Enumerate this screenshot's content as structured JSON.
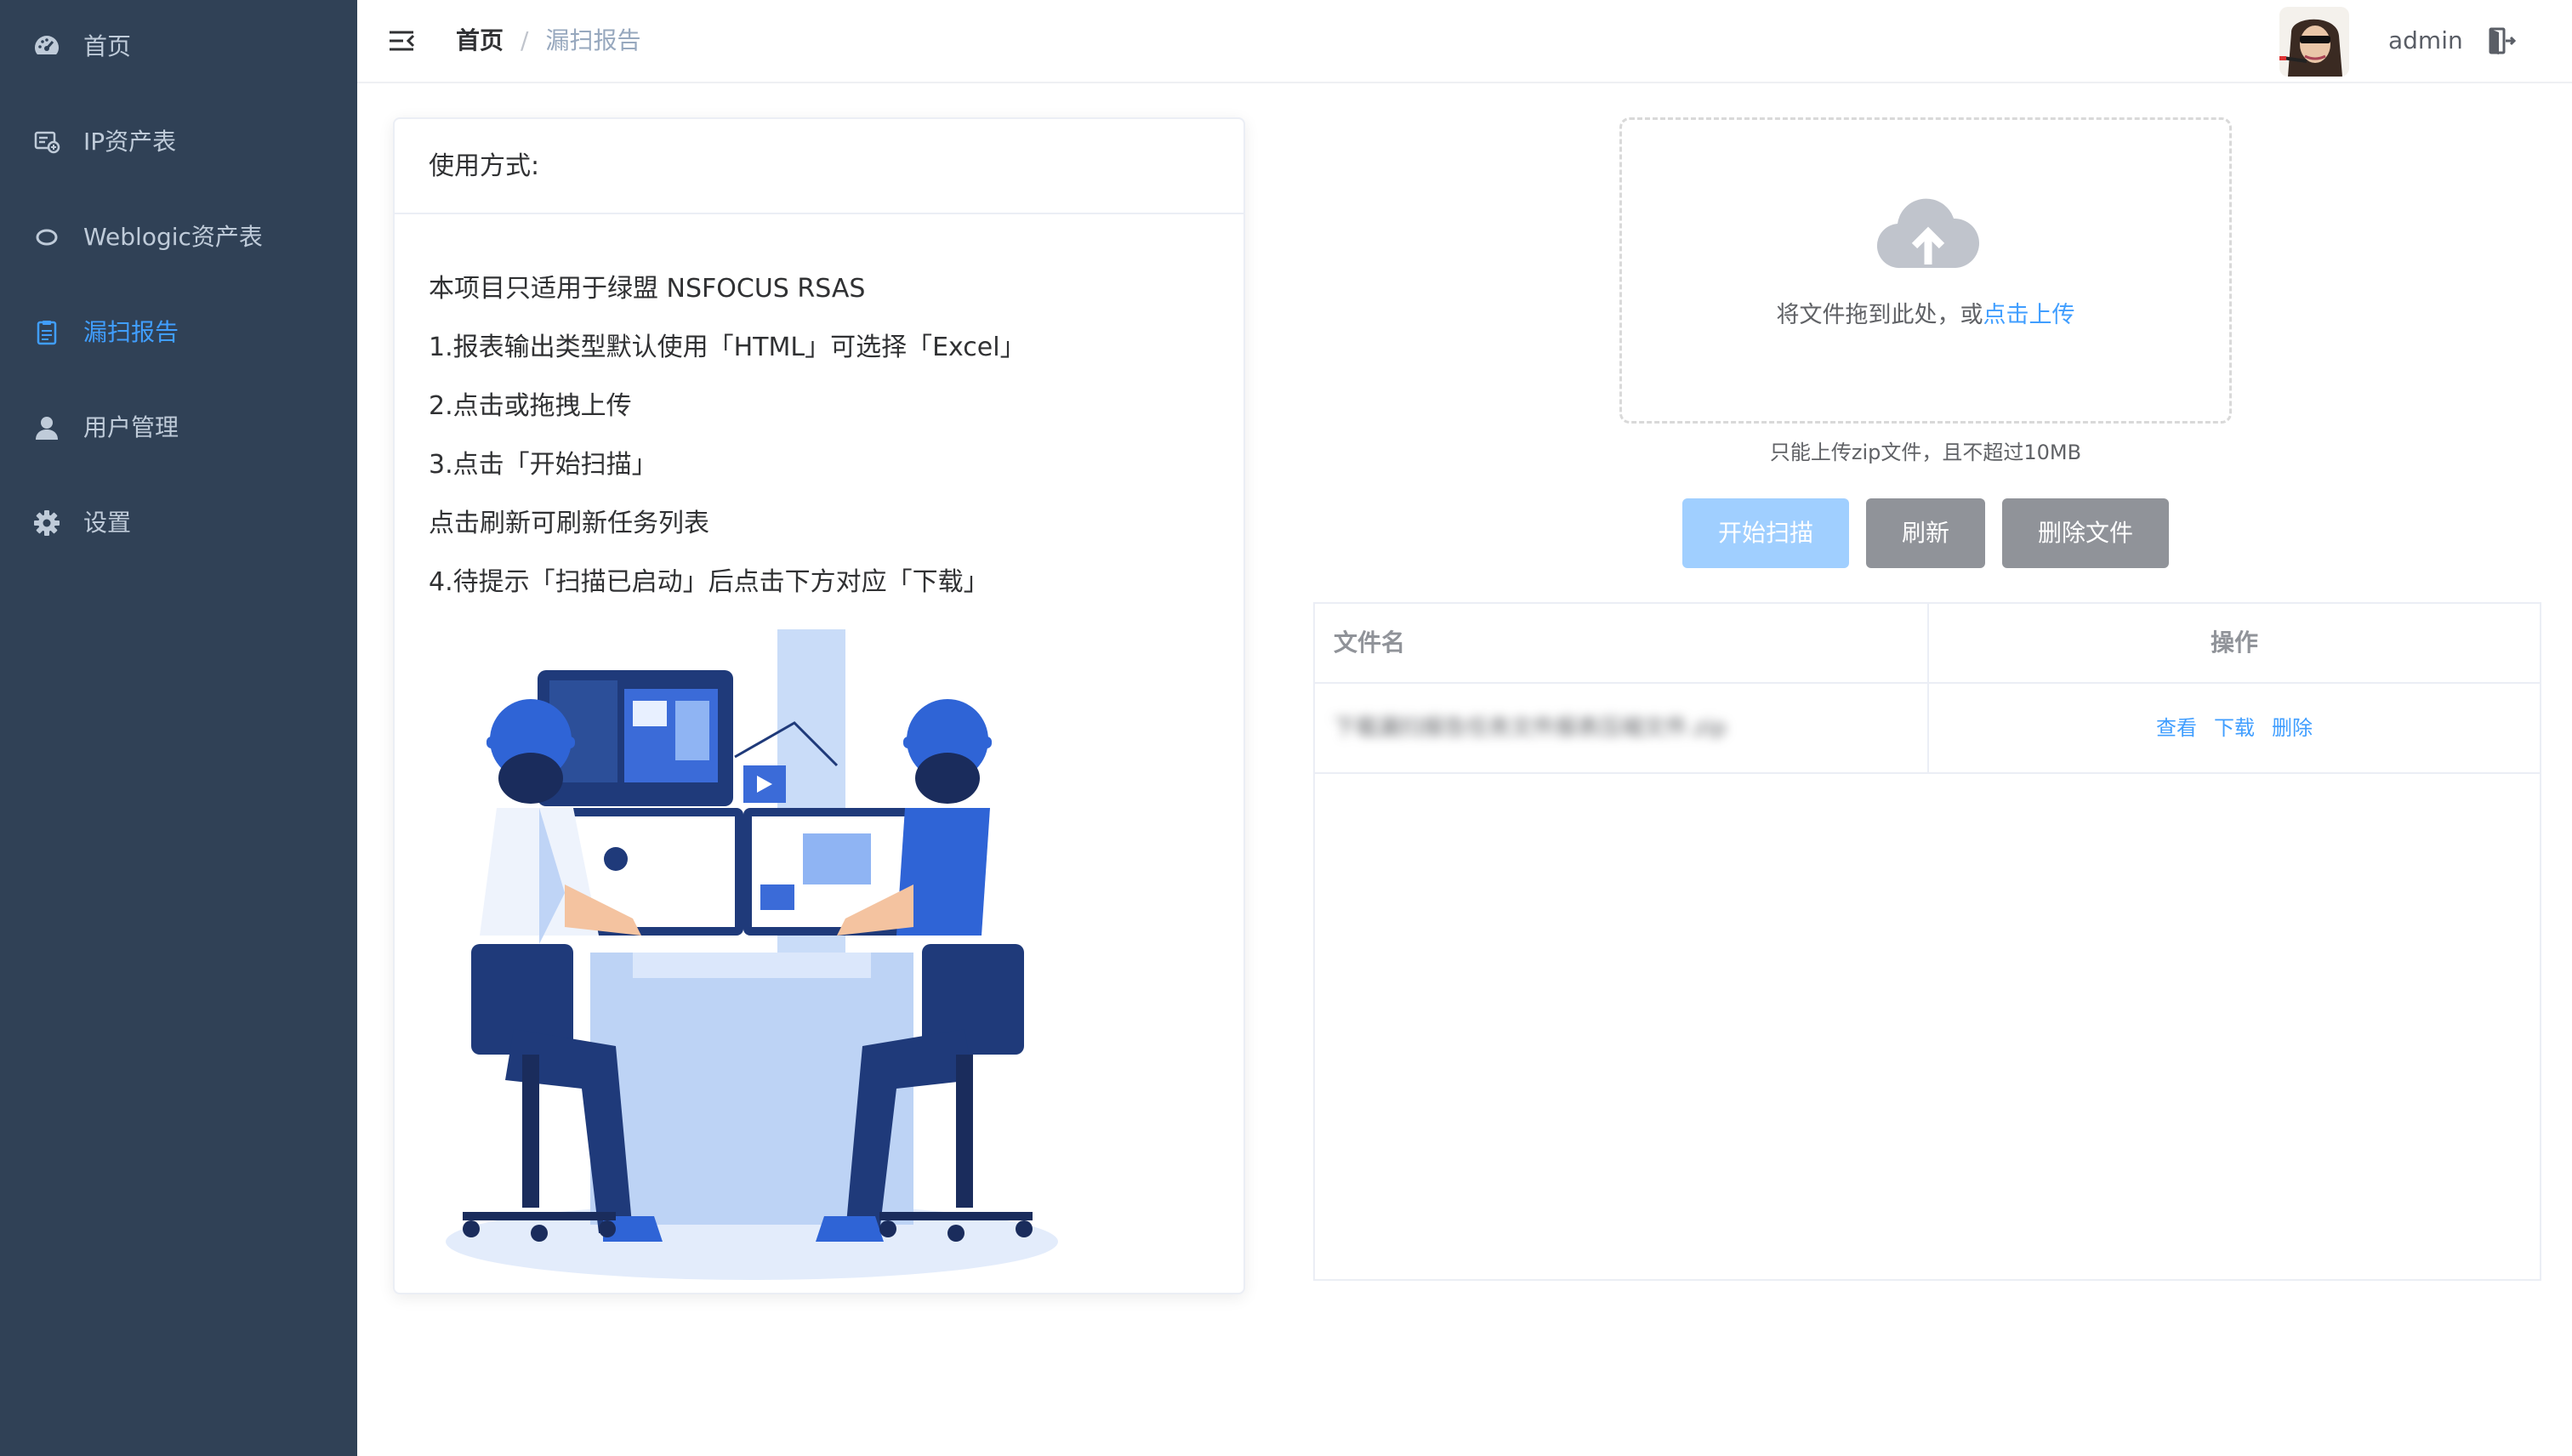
{
  "sidebar": {
    "items": [
      {
        "label": "首页",
        "icon": "dashboard-icon"
      },
      {
        "label": "IP资产表",
        "icon": "asset-icon"
      },
      {
        "label": "Weblogic资产表",
        "icon": "ring-icon"
      },
      {
        "label": "漏扫报告",
        "icon": "document-icon",
        "active": true
      },
      {
        "label": "用户管理",
        "icon": "user-icon"
      },
      {
        "label": "设置",
        "icon": "gear-icon"
      }
    ]
  },
  "header": {
    "breadcrumb": {
      "home": "首页",
      "separator": "/",
      "current": "漏扫报告"
    },
    "username": "admin"
  },
  "usage_card": {
    "title": "使用方式:",
    "lines": [
      "本项目只适用于绿盟 NSFOCUS RSAS",
      "1.报表输出类型默认使用「HTML」可选择「Excel」",
      "2.点击或拖拽上传",
      "3.点击「开始扫描」",
      "点击刷新可刷新任务列表",
      "4.待提示「扫描已启动」后点击下方对应「下载」"
    ]
  },
  "upload": {
    "text": "将文件拖到此处，或",
    "link": "点击上传",
    "tip": "只能上传zip文件，且不超过10MB"
  },
  "buttons": {
    "scan": "开始扫描",
    "refresh": "刷新",
    "delete_files": "删除文件"
  },
  "table": {
    "headers": {
      "name": "文件名",
      "ops": "操作"
    },
    "rows": [
      {
        "name": "下载漏扫报告任务文件报表压缩文件.zip",
        "ops": [
          "查看",
          "下载",
          "删除"
        ]
      }
    ]
  },
  "colors": {
    "sidebar_bg": "#304156",
    "sidebar_text": "#bfcbd9",
    "accent": "#409eff",
    "disabled_primary": "#a0cfff",
    "info": "#909399"
  }
}
